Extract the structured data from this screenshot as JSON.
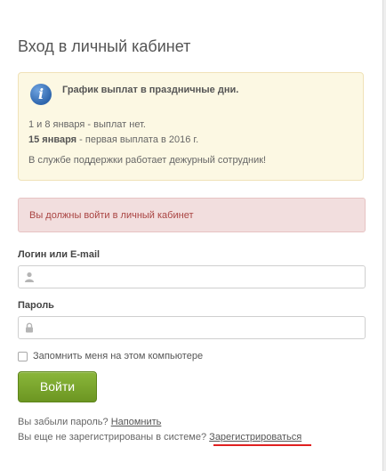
{
  "login": {
    "title": "Вход в личный кабинет",
    "notice": {
      "icon": "info-icon",
      "heading": "График выплат в праздничные дни.",
      "line1": "1 и 8 января - выплат нет.",
      "line2_bold": "15 января",
      "line2_rest": " - первая выплата в 2016 г.",
      "line3": "В службе поддержки работает дежурный сотрудник!"
    },
    "alert": "Вы должны войти в личный кабинет",
    "username": {
      "label": "Логин или E-mail",
      "value": "",
      "icon": "user-icon"
    },
    "password": {
      "label": "Пароль",
      "value": "",
      "icon": "lock-icon"
    },
    "remember": {
      "label": "Запомнить меня на этом компьютере",
      "checked": false
    },
    "submit_label": "Войти",
    "forgot": {
      "text": "Вы забыли пароль? ",
      "link": "Напомнить"
    },
    "register": {
      "text": "Вы еще не зарегистрированы в системе? ",
      "link": "Зарегистрироваться"
    }
  },
  "colors": {
    "notice_bg": "#fcf8e3",
    "alert_bg": "#f2dede",
    "alert_text": "#a94442",
    "button": "#7aa52c",
    "highlight_underline": "#e02020"
  }
}
